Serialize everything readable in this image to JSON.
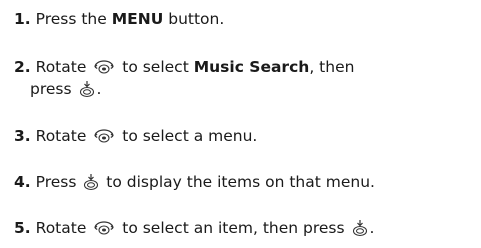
{
  "steps": [
    {
      "num": "1.",
      "a": "Press the ",
      "b": "MENU",
      "c": " button."
    },
    {
      "num": "2.",
      "a": "Rotate ",
      "icon1": "rotary-dial-icon",
      "b": " to select ",
      "bold": "Music Search",
      "c": ", then",
      "line2": "press ",
      "icon2": "push-button-icon",
      "end": "."
    },
    {
      "num": "3.",
      "a": "Rotate ",
      "icon1": "rotary-dial-icon",
      "b": " to select a menu."
    },
    {
      "num": "4.",
      "a": "Press ",
      "icon1": "push-button-icon",
      "b": " to display the items on that menu."
    },
    {
      "num": "5.",
      "a": "Rotate ",
      "icon1": "rotary-dial-icon",
      "b": " to select an item, then press ",
      "icon2": "push-button-icon",
      "c": "."
    }
  ]
}
